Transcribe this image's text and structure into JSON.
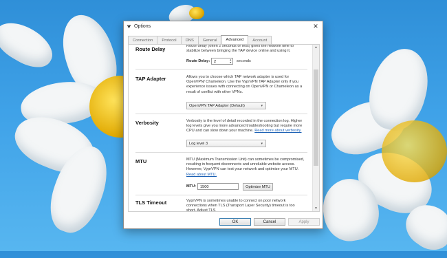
{
  "window": {
    "title": "Options"
  },
  "tabs": [
    {
      "label": "Connection"
    },
    {
      "label": "Protocol"
    },
    {
      "label": "DNS"
    },
    {
      "label": "General"
    },
    {
      "label": "Advanced",
      "active": true
    },
    {
      "label": "Account"
    }
  ],
  "route_delay": {
    "title": "Route Delay",
    "description": "Route delay (often 2 seconds or less) gives the network time to stabilize between bringing the TAP device online and using it.",
    "field_label": "Route Delay:",
    "value": "2",
    "unit": "seconds"
  },
  "tap_adapter": {
    "title": "TAP Adapter",
    "description": "Allows you to choose which TAP network adapter is used for OpenVPN/ Chameleon. Use the VyprVPN TAP Adapter only if you experience issues with connecting on OpenVPN or Chameleon as a result of conflict with other VPNs.",
    "selected": "OpenVPN TAP Adapter (Default)"
  },
  "verbosity": {
    "title": "Verbosity",
    "description": "Verbosity is the level of detail recorded in the connection log. Higher log levels give you more advanced troubleshooting but require more CPU and can slow down your machine.",
    "link": "Read more about verbosity.",
    "selected": "Log level 3"
  },
  "mtu": {
    "title": "MTU",
    "description": "MTU (Maximum Transmission Unit) can sometimes be compromised, resulting in frequent disconnects and unreliable website access. However, VyprVPN can test your network and optimize your MTU.",
    "link": "Read about MTU.",
    "field_label": "MTU:",
    "value": "1500",
    "button": "Optimize MTU"
  },
  "tls_timeout": {
    "title": "TLS Timeout",
    "description": "VyprVPN is sometimes unable to connect on poor network connections when TLS (Transport Layer Security) timeout is too short. Adjust TLS"
  },
  "footer": {
    "ok": "OK",
    "cancel": "Cancel",
    "apply": "Apply"
  },
  "icons": {
    "app": "vyprvpn-logo-icon",
    "close": "close-icon",
    "dropdown": "chevron-down-icon"
  },
  "colors": {
    "link": "#1a5fb4",
    "desktop": "#3fa2e8"
  }
}
